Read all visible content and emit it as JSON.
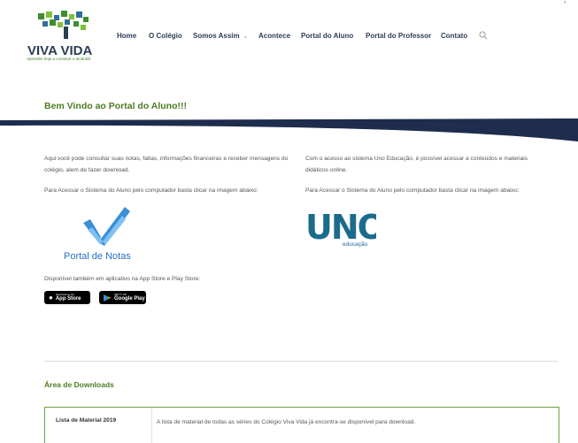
{
  "header": {
    "logo_text": "VIVA VIDA",
    "logo_tagline": "Aprender hoje a construir o amanhã.",
    "corner_mark": "'",
    "nav": [
      "Home",
      "O Colégio",
      "Somos Assim",
      "Acontece",
      "Portal do Aluno",
      "Portal do Professor",
      "Contato"
    ],
    "search_icon": "search-icon"
  },
  "main": {
    "title": "Bem Vindo ao Portal do Aluno!!!",
    "left": {
      "intro": "Aqui você pode consultar suas notas, faltas, informações financeiras e receber mensagens do colégio, alem de fazer download.",
      "access": "Para Acessar o Sistema do Aluno pelo computador basta clicar na imagem abaixo:",
      "notas_label": "Portal de Notas",
      "apps_text": "Disponível também em aplicativo na App Store e Play Store:",
      "appstore_small": "Download on the",
      "appstore_big": "App Store",
      "gplay_small": "GET IT ON",
      "gplay_big": "Google Play"
    },
    "right": {
      "intro": "Com o acesso ao sistema Uno Educação, é possível acessar a conteúdos e materiais didáticos online.",
      "access": "Para Acessar o Sistema do Aluno pelo computador basta clicar na imagem abaixo:",
      "uno_logo": "UNO",
      "uno_sub": "educação"
    }
  },
  "downloads": {
    "title": "Área de Downloads",
    "rows": [
      {
        "label": "Lista de Material 2019",
        "desc": "A lista de material de todas as séries do Colégio Viva Vida já encontra-se disponível para download."
      }
    ]
  },
  "colors": {
    "green": "#4d7d23",
    "navy": "#1e2d4d",
    "blue": "#2a6fc4",
    "uno_teal": "#1d6b8c"
  }
}
